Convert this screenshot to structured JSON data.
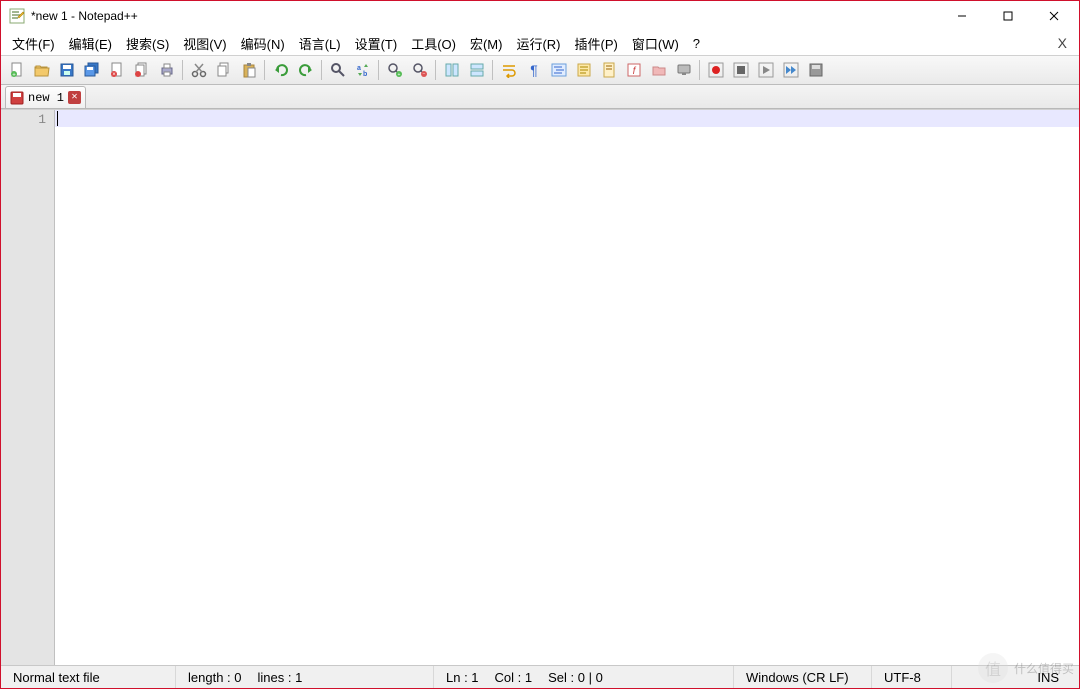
{
  "window": {
    "title": "*new 1 - Notepad++"
  },
  "menu": {
    "items": [
      "文件(F)",
      "编辑(E)",
      "搜索(S)",
      "视图(V)",
      "编码(N)",
      "语言(L)",
      "设置(T)",
      "工具(O)",
      "宏(M)",
      "运行(R)",
      "插件(P)",
      "窗口(W)",
      "?"
    ]
  },
  "toolbar": {
    "icons": [
      {
        "name": "new-file-icon"
      },
      {
        "name": "open-file-icon"
      },
      {
        "name": "save-file-icon"
      },
      {
        "name": "save-all-icon"
      },
      {
        "name": "close-file-icon"
      },
      {
        "name": "close-all-icon"
      },
      {
        "name": "print-icon"
      },
      {
        "sep": true
      },
      {
        "name": "cut-icon"
      },
      {
        "name": "copy-icon"
      },
      {
        "name": "paste-icon"
      },
      {
        "sep": true
      },
      {
        "name": "undo-icon"
      },
      {
        "name": "redo-icon"
      },
      {
        "sep": true
      },
      {
        "name": "find-icon"
      },
      {
        "name": "replace-icon"
      },
      {
        "sep": true
      },
      {
        "name": "zoom-in-icon"
      },
      {
        "name": "zoom-out-icon"
      },
      {
        "sep": true
      },
      {
        "name": "sync-v-scroll-icon"
      },
      {
        "name": "sync-h-scroll-icon"
      },
      {
        "sep": true
      },
      {
        "name": "word-wrap-icon"
      },
      {
        "name": "show-all-chars-icon"
      },
      {
        "name": "indent-guide-icon"
      },
      {
        "name": "user-lang-icon"
      },
      {
        "name": "doc-map-icon"
      },
      {
        "name": "function-list-icon"
      },
      {
        "name": "folder-workspace-icon"
      },
      {
        "name": "monitor-icon"
      },
      {
        "sep": true
      },
      {
        "name": "record-macro-icon"
      },
      {
        "name": "stop-macro-icon"
      },
      {
        "name": "play-macro-icon"
      },
      {
        "name": "play-multi-icon"
      },
      {
        "name": "save-macro-icon"
      }
    ]
  },
  "tabs": [
    {
      "label": "new 1"
    }
  ],
  "editor": {
    "line_numbers": [
      "1"
    ],
    "content": ""
  },
  "status": {
    "file_type": "Normal text file",
    "length": "length : 0",
    "lines": "lines : 1",
    "ln": "Ln : 1",
    "col": "Col : 1",
    "sel": "Sel : 0 | 0",
    "eol": "Windows (CR LF)",
    "encoding": "UTF-8",
    "mode": "INS"
  },
  "watermark": "什么值得买"
}
